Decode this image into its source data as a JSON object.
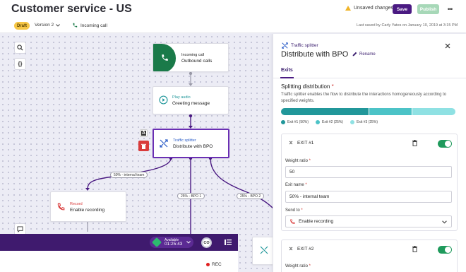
{
  "header": {
    "title": "Customer service - US",
    "unsaved": "Unsaved changes",
    "save": "Save",
    "publish": "Publish",
    "more": "•••"
  },
  "subheader": {
    "badge": "Draft",
    "version": "Version 2",
    "incoming": "Incoming call",
    "last_saved": "Last saved by Carly Yates on January 10, 2019 at 3:15 PM"
  },
  "canvas": {
    "nodes": {
      "incoming": {
        "type": "Incoming call",
        "name": "Outbound calls"
      },
      "play_audio": {
        "type": "Play audio",
        "name": "Greeting message"
      },
      "splitter": {
        "type": "Traffic splitter",
        "name": "Distribute with BPO"
      },
      "record": {
        "type": "Record",
        "name": "Enable recording"
      }
    },
    "edge_labels": {
      "e1": "50% - internal team",
      "e2": "25% - BPO 1",
      "e3": "25% - BPO 2"
    },
    "tool_a": "A",
    "tool_braces": "{}"
  },
  "agent_bar": {
    "status_label": "Available",
    "timer": "01:25:43",
    "initials": "CO",
    "rec": "REC"
  },
  "panel": {
    "type": "Traffic splitter",
    "title": "Distribute with BPO",
    "rename": "Rename",
    "tab": "Exits",
    "split_title": "Splitting distribution",
    "split_desc": "Traffic splitter enables the flow to distribute the interactions homogeneously according to specified weights.",
    "distribution": [
      {
        "label": "Exit #1 (50%)",
        "value": 50,
        "color": "#21979a"
      },
      {
        "label": "Exit #2 (25%)",
        "value": 25,
        "color": "#4cc3c7"
      },
      {
        "label": "Exit #3 (25%)",
        "value": 25,
        "color": "#8fe1e3"
      }
    ],
    "exit1": {
      "name": "EXIT #1",
      "weight_label": "Weight ratio",
      "weight_value": "50",
      "exit_name_label": "Exit name",
      "exit_name_value": "50% - internal  team",
      "send_to_label": "Send to",
      "send_to_value": "Enable recording",
      "enabled": true
    },
    "exit2": {
      "name": "EXIT #2",
      "weight_label": "Weight ratio",
      "enabled": true
    }
  },
  "colors": {
    "accent": "#4a1a82",
    "toggle_on": "#1f9a5c",
    "node_selected": "#6a2fb3",
    "incoming_green": "#1a7a49"
  }
}
